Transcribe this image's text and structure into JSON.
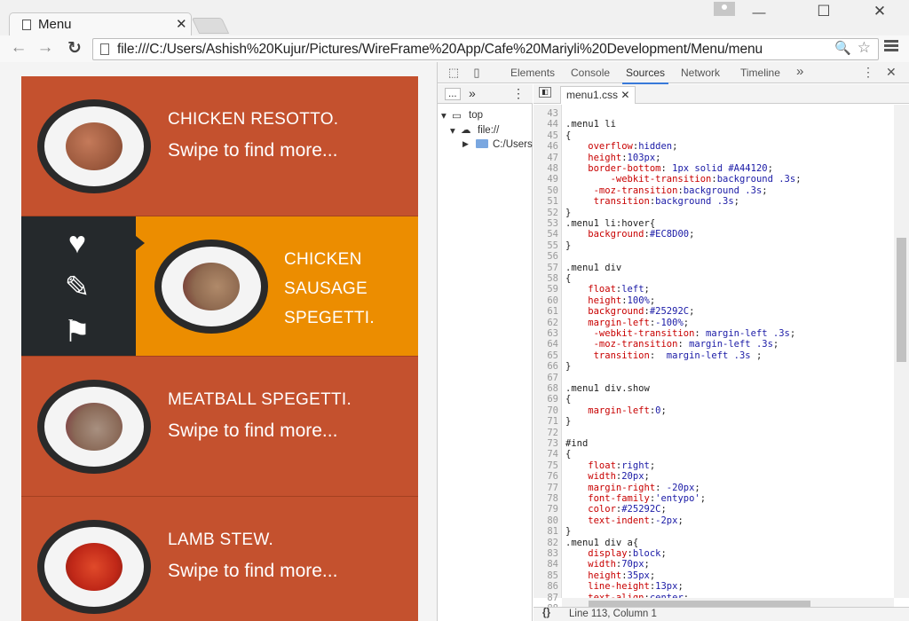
{
  "browser": {
    "tab_title": "Menu",
    "tab_close": "✕",
    "url": "file:///C:/Users/Ashish%20Kujur/Pictures/WireFrame%20App/Cafe%20Mariyli%20Development/Menu/menu",
    "back": "←",
    "forward": "→",
    "reload": "↻",
    "minimize": "—",
    "maximize": "☐",
    "close": "✕",
    "zoom_icon": "🔍",
    "star": "☆"
  },
  "menu": {
    "items": [
      {
        "name": "CHICKEN RESOTTO.",
        "sub": "Swipe to find more..."
      },
      {
        "name_lines": [
          "CHICKEN",
          "SAUSAGE",
          "SPEGETTI."
        ]
      },
      {
        "name": "MEATBALL SPEGETTI.",
        "sub": "Swipe to find more..."
      },
      {
        "name": "LAMB STEW.",
        "sub": "Swipe to find more..."
      }
    ],
    "side_icons": {
      "heart": "♥",
      "pencil": "✎",
      "flag": "⚑"
    }
  },
  "colors": {
    "item_bg": "#C4512E",
    "hover_bg": "#EC8D00",
    "side_bg": "#25292C",
    "border": "#A44120"
  },
  "devtools": {
    "tabs": [
      "Elements",
      "Console",
      "Sources",
      "Network",
      "Timeline"
    ],
    "active_tab": "Sources",
    "more": "»",
    "kebab": "⋮",
    "close": "✕",
    "nav_more": "...",
    "nav_chevron": "»",
    "tree": [
      "top",
      "file://",
      "C:/Users"
    ],
    "file_tab": "menu1.css",
    "status": "Line 113, Column 1",
    "braces": "{}",
    "code": [
      {
        "n": "43",
        "t": ""
      },
      {
        "n": "44",
        "t": ".menu1 li"
      },
      {
        "n": "45",
        "t": "{"
      },
      {
        "n": "46",
        "p": "    overflow",
        "v": "hidden",
        "e": ";"
      },
      {
        "n": "47",
        "p": "    height",
        "v": "103px",
        "e": ";"
      },
      {
        "n": "48",
        "p": "    border-bottom",
        "v": " 1px solid #A44120",
        "e": ";"
      },
      {
        "n": "49",
        "p": "        -webkit-transition",
        "v": "background .3s",
        "e": ";"
      },
      {
        "n": "50",
        "p": "     -moz-transition",
        "v": "background .3s",
        "e": ";"
      },
      {
        "n": "51",
        "p": "     transition",
        "v": "background .3s",
        "e": ";"
      },
      {
        "n": "52",
        "t": "}"
      },
      {
        "n": "53",
        "t": ".menu1 li:hover{"
      },
      {
        "n": "54",
        "p": "    background",
        "v": "#EC8D00",
        "e": ";"
      },
      {
        "n": "55",
        "t": "}"
      },
      {
        "n": "56",
        "t": ""
      },
      {
        "n": "57",
        "t": ".menu1 div"
      },
      {
        "n": "58",
        "t": "{"
      },
      {
        "n": "59",
        "p": "    float",
        "v": "left",
        "e": ";"
      },
      {
        "n": "60",
        "p": "    height",
        "v": "100%",
        "e": ";"
      },
      {
        "n": "61",
        "p": "    background",
        "v": "#25292C",
        "e": ";"
      },
      {
        "n": "62",
        "p": "    margin-left",
        "v": "-100%",
        "e": ";"
      },
      {
        "n": "63",
        "p": "     -webkit-transition",
        "v": " margin-left .3s",
        "e": ";"
      },
      {
        "n": "64",
        "p": "     -moz-transition",
        "v": " margin-left .3s",
        "e": ";"
      },
      {
        "n": "65",
        "p": "     transition",
        "v": "  margin-left .3s ",
        "e": ";"
      },
      {
        "n": "66",
        "t": "}"
      },
      {
        "n": "67",
        "t": ""
      },
      {
        "n": "68",
        "t": ".menu1 div.show"
      },
      {
        "n": "69",
        "t": "{"
      },
      {
        "n": "70",
        "p": "    margin-left",
        "v": "0",
        "e": ";"
      },
      {
        "n": "71",
        "t": "}"
      },
      {
        "n": "72",
        "t": ""
      },
      {
        "n": "73",
        "t": "#ind"
      },
      {
        "n": "74",
        "t": "{"
      },
      {
        "n": "75",
        "p": "    float",
        "v": "right",
        "e": ";"
      },
      {
        "n": "76",
        "p": "    width",
        "v": "20px",
        "e": ";"
      },
      {
        "n": "77",
        "p": "    margin-right",
        "v": " -20px",
        "e": ";"
      },
      {
        "n": "78",
        "p": "    font-family",
        "v": "'entypo'",
        "e": ";"
      },
      {
        "n": "79",
        "p": "    color",
        "v": "#25292C",
        "e": ";"
      },
      {
        "n": "80",
        "p": "    text-indent",
        "v": "-2px",
        "e": ";"
      },
      {
        "n": "81",
        "t": "}"
      },
      {
        "n": "82",
        "t": ".menu1 div a{"
      },
      {
        "n": "83",
        "p": "    display",
        "v": "block",
        "e": ";"
      },
      {
        "n": "84",
        "p": "    width",
        "v": "70px",
        "e": ";"
      },
      {
        "n": "85",
        "p": "    height",
        "v": "35px",
        "e": ";"
      },
      {
        "n": "86",
        "p": "    line-height",
        "v": "13px",
        "e": ";"
      },
      {
        "n": "87",
        "p": "    text-align",
        "v": "center",
        "e": ";"
      },
      {
        "n": "88",
        "t": ""
      }
    ]
  }
}
